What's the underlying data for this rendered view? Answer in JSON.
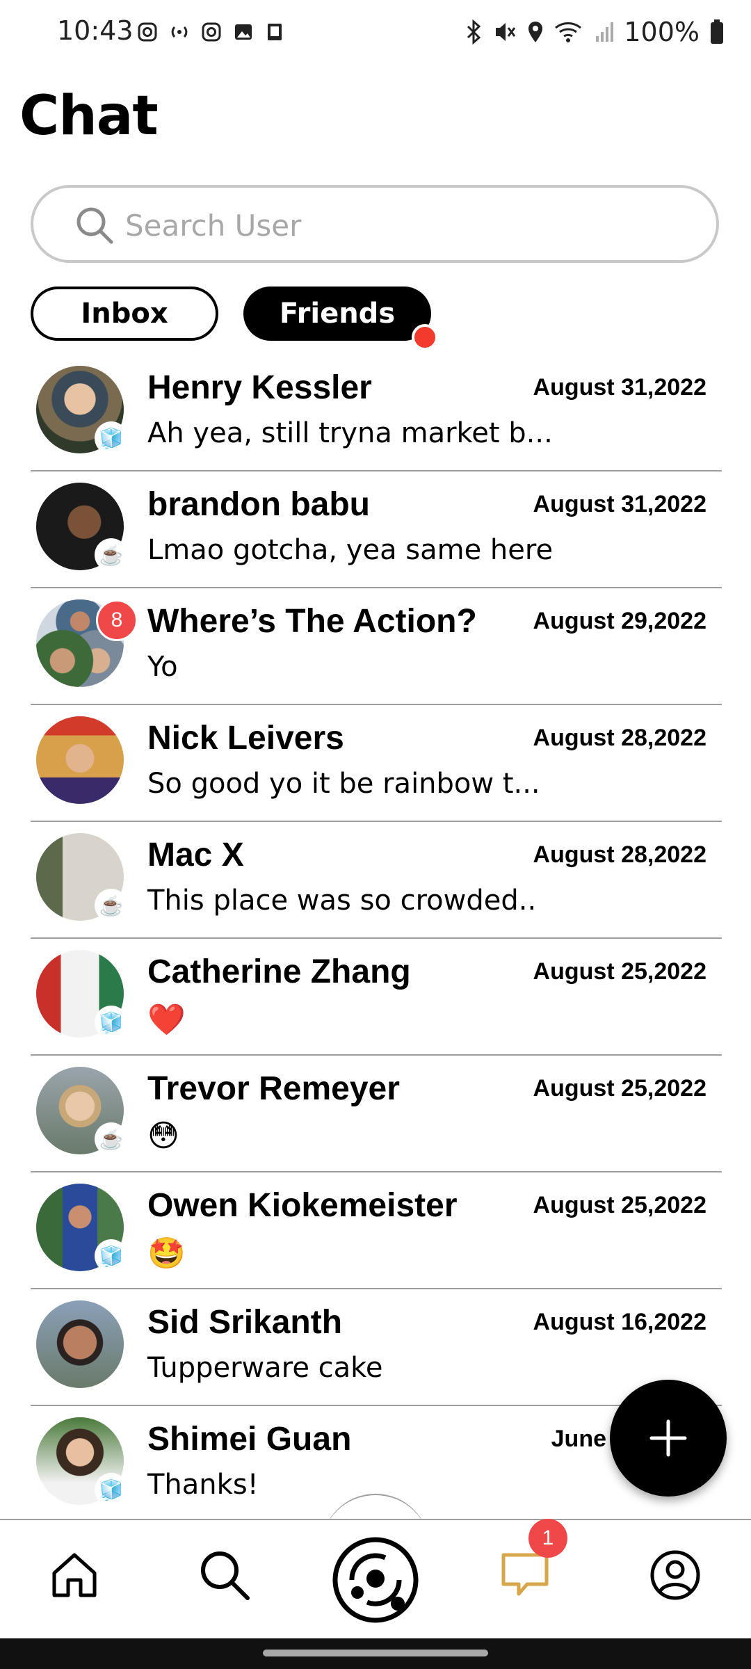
{
  "status_bar": {
    "time": "10:43",
    "battery": "100%"
  },
  "header": {
    "title": "Chat"
  },
  "search": {
    "placeholder": "Search User"
  },
  "tabs": {
    "inbox": "Inbox",
    "friends": "Friends"
  },
  "chats": [
    {
      "name": "Henry Kessler",
      "date": "August 31,2022",
      "message": "Ah yea, still tryna market b...",
      "status": "ice"
    },
    {
      "name": "brandon babu",
      "date": "August 31,2022",
      "message": "Lmao gotcha, yea same here",
      "status": "coffee"
    },
    {
      "name": "Where’s The Action?",
      "date": "August 29,2022",
      "message": "Yo",
      "unread": "8"
    },
    {
      "name": "Nick Leivers",
      "date": "August 28,2022",
      "message": "So good yo it be rainbow t..."
    },
    {
      "name": "Mac X",
      "date": "August 28,2022",
      "message": "This place was so crowded..",
      "status": "coffee"
    },
    {
      "name": "Catherine Zhang",
      "date": "August 25,2022",
      "message": "❤️",
      "status": "ice"
    },
    {
      "name": "Trevor Remeyer",
      "date": "August 25,2022",
      "message": "😳",
      "status": "coffee"
    },
    {
      "name": "Owen Kiokemeister",
      "date": "August 25,2022",
      "message": "🤩",
      "status": "ice"
    },
    {
      "name": "Sid Srikanth",
      "date": "August 16,2022",
      "message": "Tupperware cake"
    },
    {
      "name": "Shimei Guan",
      "date": "June",
      "message": "Thanks!",
      "status": "ice"
    }
  ],
  "bottom_nav": {
    "chat_badge": "1",
    "chat_icon_color": "#d8a64a"
  },
  "colors": {
    "accent_red": "#f23b2c",
    "badge_red": "#f04848"
  }
}
